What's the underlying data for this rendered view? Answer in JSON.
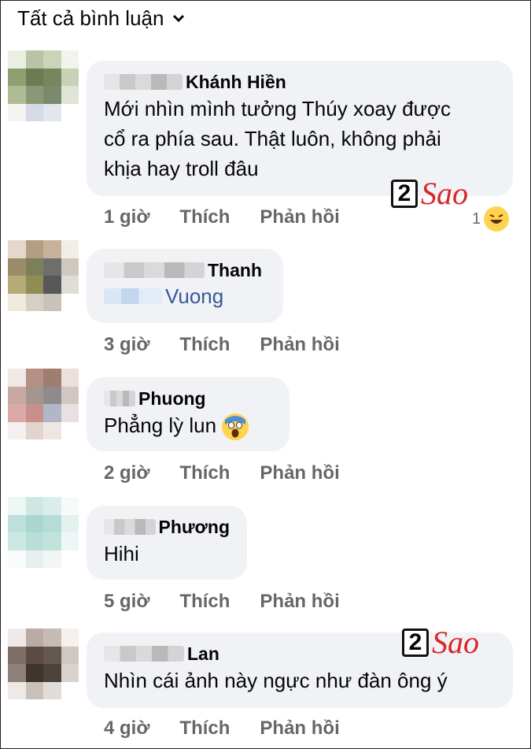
{
  "header": {
    "filter_label": "Tất cả bình luận"
  },
  "watermark": {
    "digit": "2",
    "word": "Sao"
  },
  "comments": [
    {
      "name": "Khánh Hiền",
      "text_lines": [
        "Mới nhìn mình tưởng Thúy xoay được",
        "cổ ra phía sau. Thật luôn, không phải",
        "khịa hay troll đâu"
      ],
      "time": "1 giờ",
      "like": "Thích",
      "reply": "Phản hồi",
      "reaction_count": "1"
    },
    {
      "name": "Thanh",
      "tag": "Vuong",
      "time": "3 giờ",
      "like": "Thích",
      "reply": "Phản hồi"
    },
    {
      "name": "Phuong",
      "text": "Phẳng lỳ lun",
      "time": "2 giờ",
      "like": "Thích",
      "reply": "Phản hồi"
    },
    {
      "name": "Phương",
      "text": "Hihi",
      "time": "5 giờ",
      "like": "Thích",
      "reply": "Phản hồi"
    },
    {
      "name": "Lan",
      "text": "Nhìn cái ảnh này ngực như đàn ông ý",
      "time": "4 giờ",
      "like": "Thích",
      "reply": "Phản hồi"
    }
  ],
  "colors": {
    "bubble": "#f0f2f5",
    "meta": "#65676b",
    "link": "#385898",
    "watermark": "#d9262b"
  }
}
